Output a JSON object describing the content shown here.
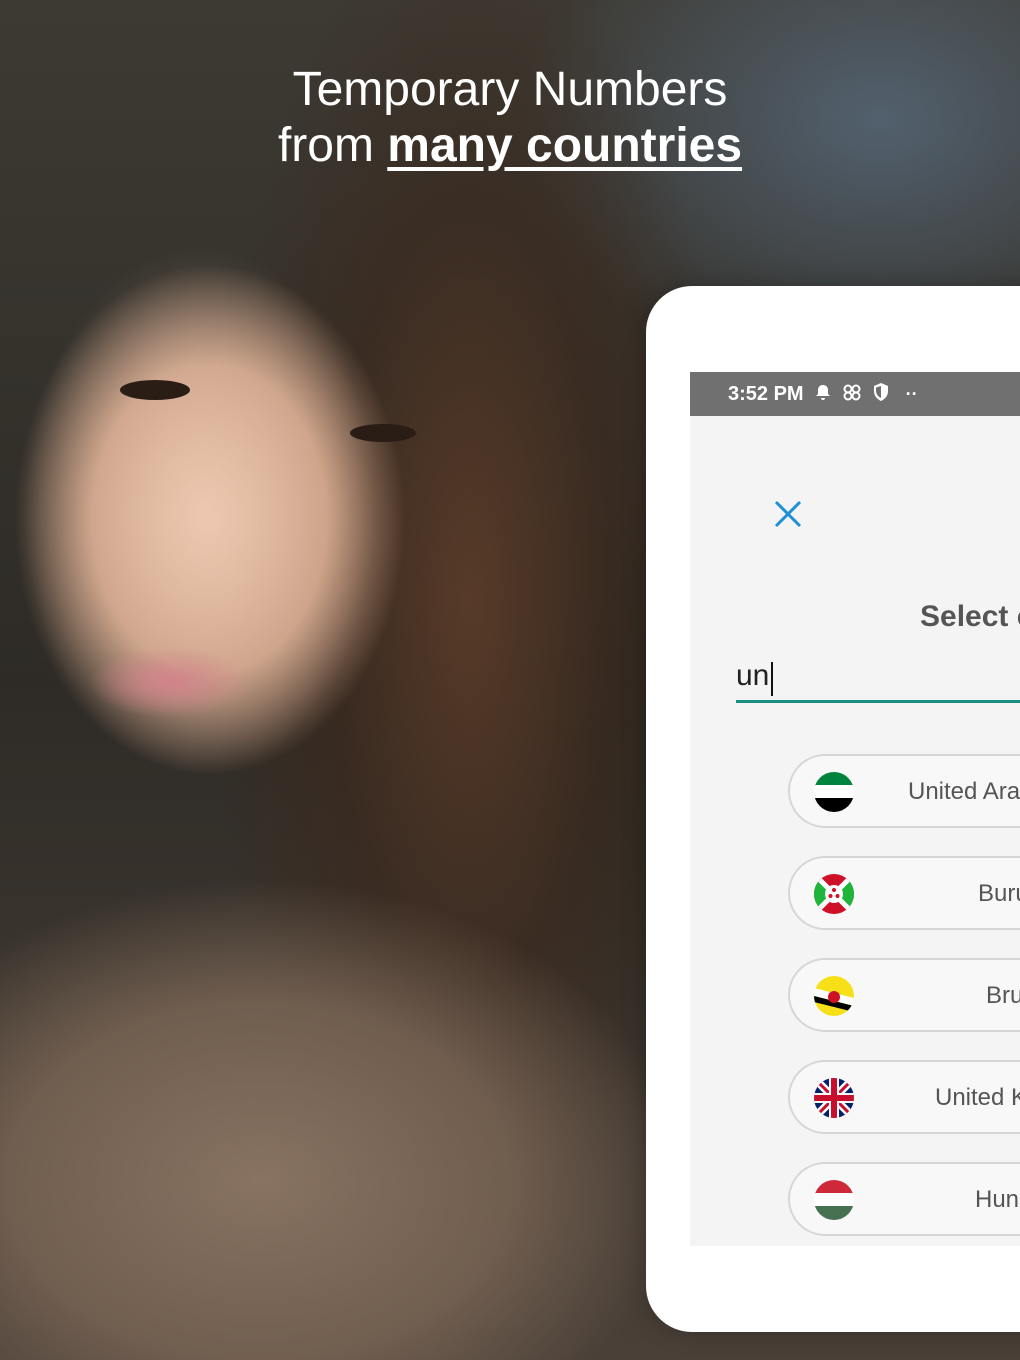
{
  "headline": {
    "line1": "Temporary Numbers",
    "line2_prefix": "from ",
    "line2_emphasis": "many countries"
  },
  "status_bar": {
    "time": "3:52 PM",
    "icons": [
      "bell-icon",
      "network-icon",
      "shield-icon",
      "more-dots-icon"
    ],
    "more": "··"
  },
  "dialog": {
    "title": "Select c",
    "search_value": "un"
  },
  "countries": [
    {
      "name": "United Aral",
      "flag": "uae-flag"
    },
    {
      "name": "Buru",
      "flag": "burundi-flag"
    },
    {
      "name": "Bru",
      "flag": "brunei-flag"
    },
    {
      "name": "United K",
      "flag": "uk-flag"
    },
    {
      "name": "Hung",
      "flag": "hungary-flag"
    }
  ],
  "colors": {
    "accent": "#1b8e86",
    "close_icon": "#1f8fd6",
    "status_bar": "#707070"
  }
}
